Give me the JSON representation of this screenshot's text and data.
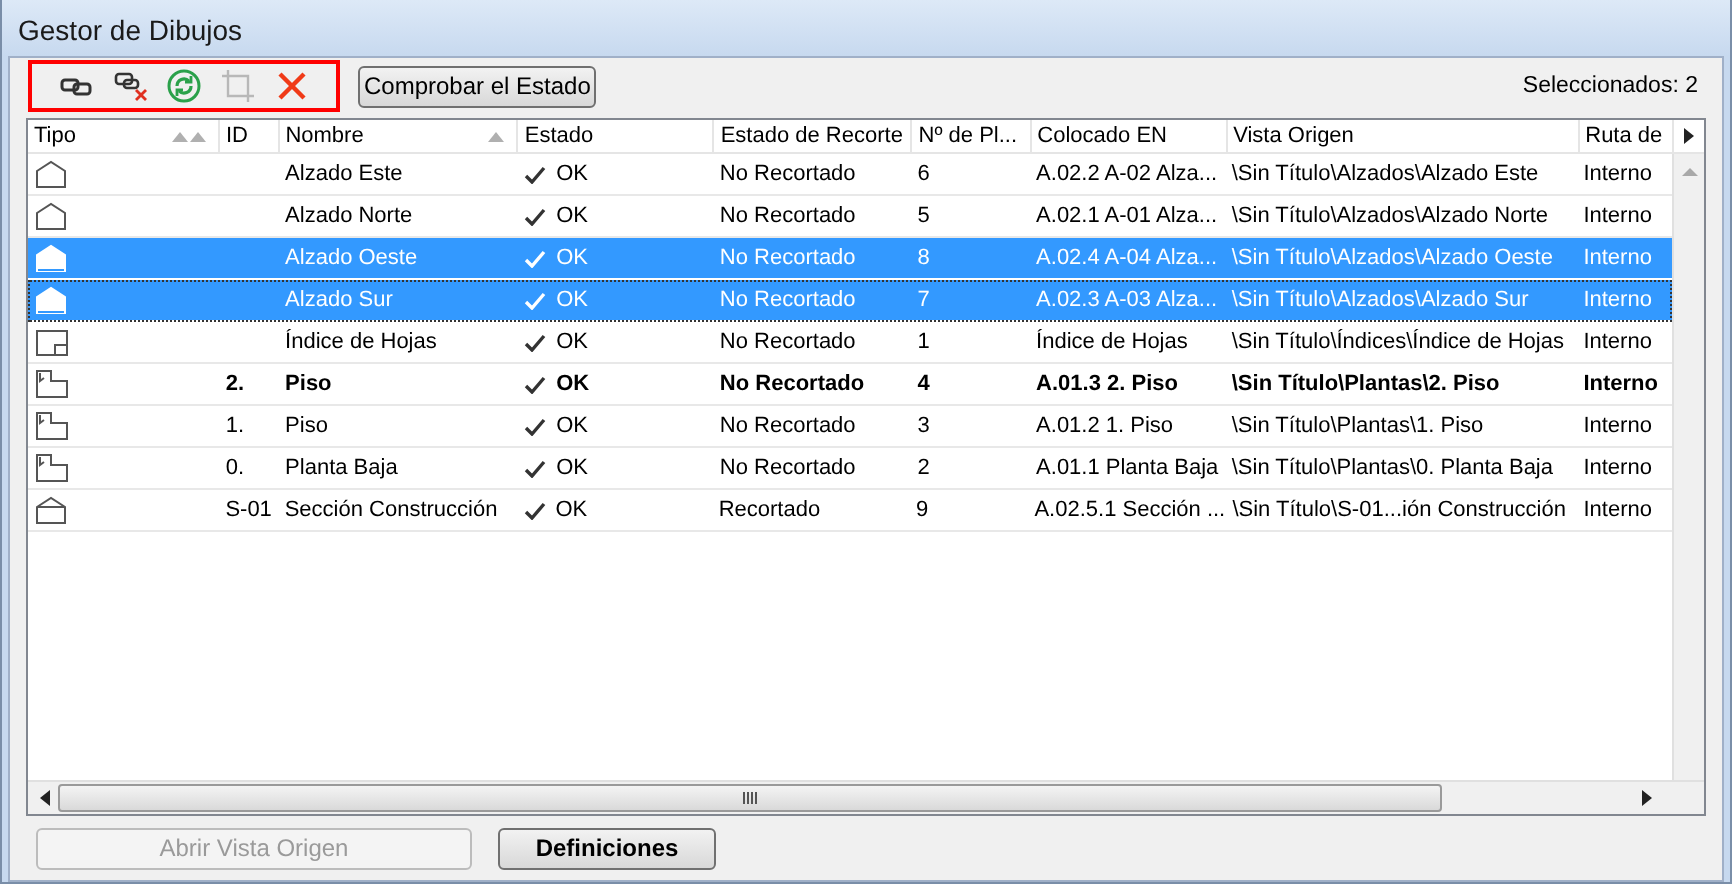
{
  "window": {
    "title": "Gestor de Dibujos"
  },
  "toolbar": {
    "highlighted": true,
    "tools": [
      {
        "kind": "link",
        "disabled": false
      },
      {
        "kind": "unlink",
        "disabled": false
      },
      {
        "kind": "update",
        "disabled": false
      },
      {
        "kind": "crop",
        "disabled": true
      },
      {
        "kind": "delete",
        "disabled": false
      }
    ],
    "check_button": "Comprobar el Estado",
    "selection_count": "Seleccionados: 2"
  },
  "table": {
    "columns": [
      {
        "label": "Tipo",
        "kind": "double-sorted"
      },
      {
        "label": "ID",
        "kind": "plain"
      },
      {
        "label": "Nombre",
        "kind": "sorted"
      },
      {
        "label": "Estado",
        "kind": "plain"
      },
      {
        "label": "Estado de Recorte",
        "kind": "plain"
      },
      {
        "label": "Nº de Pl...",
        "kind": "plain"
      },
      {
        "label": "Colocado EN",
        "kind": "plain"
      },
      {
        "label": "Vista Origen",
        "kind": "plain"
      },
      {
        "label": "Ruta de",
        "kind": "plain"
      }
    ],
    "rows": [
      {
        "kind": "elevation",
        "id": "",
        "name": "Alzado Este",
        "status": "OK",
        "clipping": "No Recortado",
        "sheet_no": "6",
        "placed_in": "A.02.2 A-02 Alza...",
        "source_view": "\\Sin Título\\Alzados\\Alzado Este",
        "path": "Interno",
        "selected": false,
        "bold": false,
        "focused": false
      },
      {
        "kind": "elevation",
        "id": "",
        "name": "Alzado Norte",
        "status": "OK",
        "clipping": "No Recortado",
        "sheet_no": "5",
        "placed_in": "A.02.1 A-01 Alza...",
        "source_view": "\\Sin Título\\Alzados\\Alzado Norte",
        "path": "Interno",
        "selected": false,
        "bold": false,
        "focused": false
      },
      {
        "kind": "elevation",
        "id": "",
        "name": "Alzado Oeste",
        "status": "OK",
        "clipping": "No Recortado",
        "sheet_no": "8",
        "placed_in": "A.02.4 A-04 Alza...",
        "source_view": "\\Sin Título\\Alzados\\Alzado Oeste",
        "path": "Interno",
        "selected": true,
        "bold": false,
        "focused": false
      },
      {
        "kind": "elevation",
        "id": "",
        "name": "Alzado Sur",
        "status": "OK",
        "clipping": "No Recortado",
        "sheet_no": "7",
        "placed_in": "A.02.3 A-03 Alza...",
        "source_view": "\\Sin Título\\Alzados\\Alzado Sur",
        "path": "Interno",
        "selected": true,
        "bold": false,
        "focused": true
      },
      {
        "kind": "index",
        "id": "",
        "name": "Índice de Hojas",
        "status": "OK",
        "clipping": "No Recortado",
        "sheet_no": "1",
        "placed_in": "Índice de Hojas",
        "source_view": "\\Sin Título\\Índices\\Índice de Hojas",
        "path": "Interno",
        "selected": false,
        "bold": false,
        "focused": false
      },
      {
        "kind": "plan",
        "id": "2.",
        "name": "Piso",
        "status": "OK",
        "clipping": "No Recortado",
        "sheet_no": "4",
        "placed_in": "A.01.3 2. Piso",
        "source_view": "\\Sin Título\\Plantas\\2. Piso",
        "path": "Interno",
        "selected": false,
        "bold": true,
        "focused": false
      },
      {
        "kind": "plan",
        "id": "1.",
        "name": "Piso",
        "status": "OK",
        "clipping": "No Recortado",
        "sheet_no": "3",
        "placed_in": "A.01.2 1. Piso",
        "source_view": "\\Sin Título\\Plantas\\1. Piso",
        "path": "Interno",
        "selected": false,
        "bold": false,
        "focused": false
      },
      {
        "kind": "plan",
        "id": "0.",
        "name": "Planta Baja",
        "status": "OK",
        "clipping": "No Recortado",
        "sheet_no": "2",
        "placed_in": "A.01.1 Planta Baja",
        "source_view": "\\Sin Título\\Plantas\\0. Planta Baja",
        "path": "Interno",
        "selected": false,
        "bold": false,
        "focused": false
      },
      {
        "kind": "section",
        "id": "S-01",
        "name": "Sección Construcción",
        "status": "OK",
        "clipping": "Recortado",
        "sheet_no": "9",
        "placed_in": "A.02.5.1 Sección ...",
        "source_view": "\\Sin Título\\S-01...ión Construcción",
        "path": "Interno",
        "selected": false,
        "bold": false,
        "focused": false
      }
    ]
  },
  "footer": {
    "buttons": [
      {
        "label": "Abrir Vista Origen",
        "disabled": true
      },
      {
        "label": "Definiciones",
        "disabled": false
      }
    ]
  }
}
